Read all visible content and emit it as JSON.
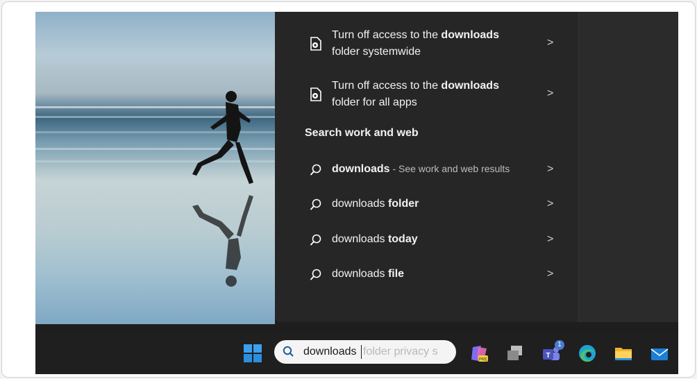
{
  "flyout": {
    "results": [
      {
        "pre": "Turn off access to the ",
        "bold": "downloads",
        "line2": "folder systemwide",
        "icon": "settings-file-icon"
      },
      {
        "pre": "Turn off access to the ",
        "bold": "downloads",
        "line2": "folder for all apps",
        "icon": "settings-file-icon"
      }
    ],
    "section_title": "Search work and web",
    "web_results": [
      {
        "term": "downloads",
        "bold": "",
        "sub": " - See work and web results"
      },
      {
        "term": "downloads ",
        "bold": "folder",
        "sub": ""
      },
      {
        "term": "downloads ",
        "bold": "today",
        "sub": ""
      },
      {
        "term": "downloads ",
        "bold": "file",
        "sub": ""
      }
    ],
    "chevron": ">"
  },
  "taskbar": {
    "search_value": "downloads",
    "search_ghost": "folder privacy s",
    "teams_badge": "1",
    "icons": [
      "windows-start-icon",
      "search-icon",
      "copilot-icon",
      "colorful-app-icon",
      "task-view-icon",
      "teams-icon",
      "edge-icon",
      "file-explorer-icon",
      "mail-icon"
    ]
  },
  "colors": {
    "flyout_bg": "#262626",
    "taskbar_bg": "#1f1f1f",
    "accent": "#4a7bd1"
  }
}
